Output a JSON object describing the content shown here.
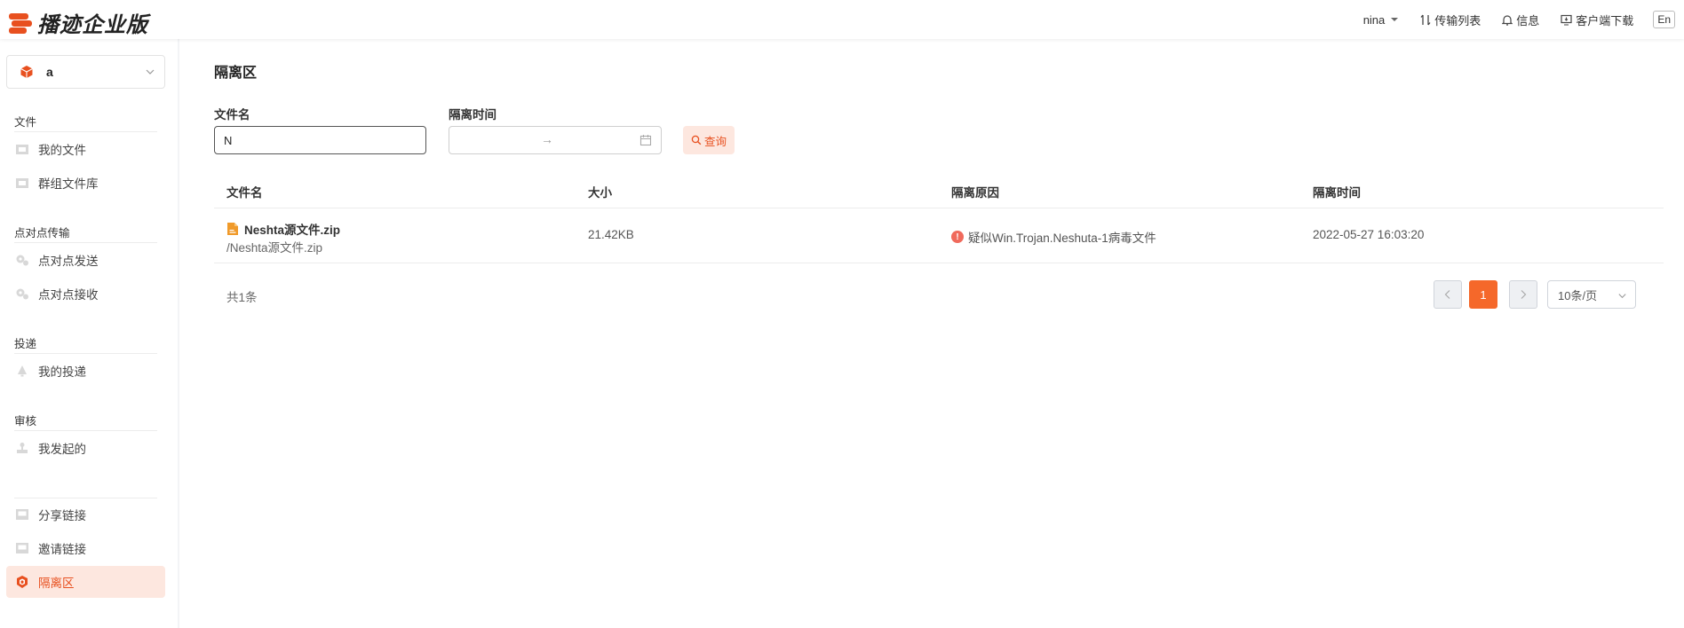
{
  "app": {
    "logo_text": "播迹企业版"
  },
  "header": {
    "user": "nina",
    "transfer_list": "传输列表",
    "messages": "信息",
    "client_download": "客户端下载",
    "language": "En"
  },
  "sidebar": {
    "space_name": "a",
    "sections": {
      "files": "文件",
      "p2p": "点对点传输",
      "delivery": "投递",
      "review": "审核"
    },
    "items": {
      "my_files": "我的文件",
      "group_library": "群组文件库",
      "p2p_send": "点对点发送",
      "p2p_receive": "点对点接收",
      "my_delivery": "我的投递",
      "my_initiated": "我发起的",
      "share_links": "分享链接",
      "invite_links": "邀请链接",
      "quarantine": "隔离区"
    }
  },
  "main": {
    "title": "隔离区",
    "filters": {
      "name_label": "文件名",
      "name_value": "N",
      "time_label": "隔离时间",
      "date_sep": "→",
      "query": "查询"
    },
    "table": {
      "headers": [
        "文件名",
        "大小",
        "隔离原因",
        "隔离时间"
      ],
      "rows": [
        {
          "name": "Neshta源文件.zip",
          "path": "/Neshta源文件.zip",
          "size": "21.42KB",
          "reason": "疑似Win.Trojan.Neshuta-1病毒文件",
          "time": "2022-05-27 16:03:20"
        }
      ]
    },
    "pagination": {
      "total": "共1条",
      "current": "1",
      "page_size": "10条/页"
    }
  },
  "colors": {
    "brand": "#e8501f",
    "active_bg": "#fde7df",
    "page_current": "#f5682a",
    "warn": "#f06a5c"
  }
}
